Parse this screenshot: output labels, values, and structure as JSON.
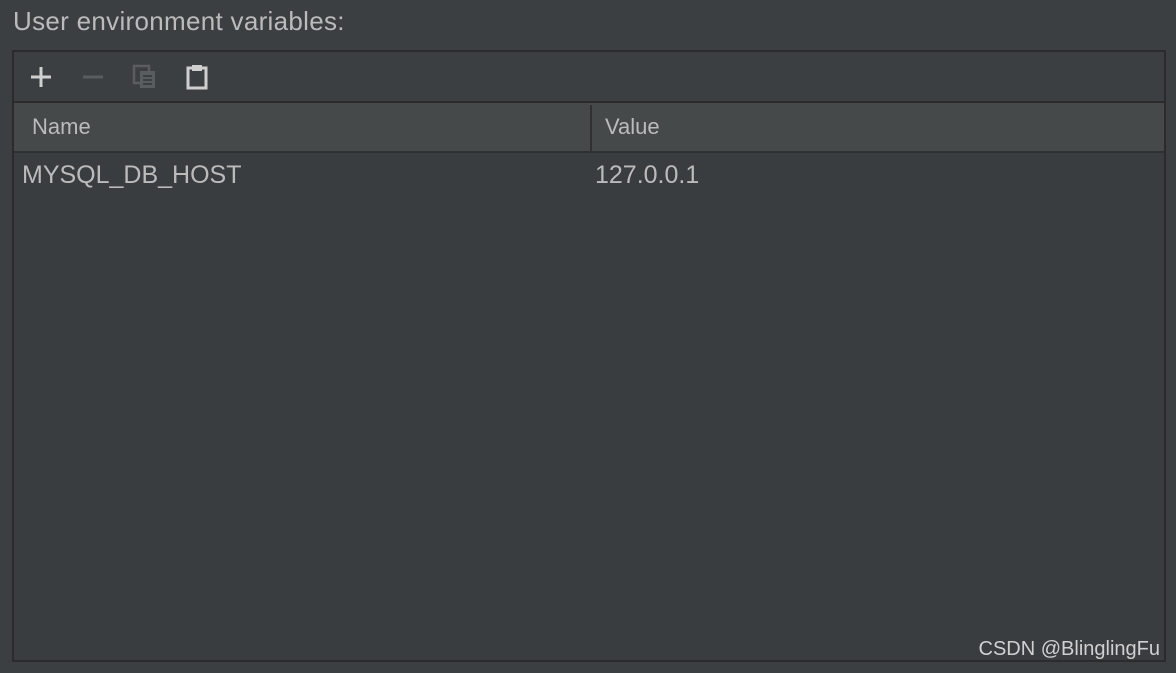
{
  "section": {
    "title": "User environment variables:"
  },
  "toolbar": {
    "add": {
      "icon": "plus-icon",
      "enabled": true
    },
    "remove": {
      "icon": "minus-icon",
      "enabled": false
    },
    "copy": {
      "icon": "copy-icon",
      "enabled": false
    },
    "paste": {
      "icon": "paste-icon",
      "enabled": true
    }
  },
  "table": {
    "columns": [
      "Name",
      "Value"
    ],
    "rows": [
      {
        "name": "MYSQL_DB_HOST",
        "value": "127.0.0.1"
      }
    ]
  },
  "watermark": "CSDN @BlinglingFu",
  "colors": {
    "background": "#3c3f41",
    "header": "#45494a",
    "text": "#bbbbbb",
    "border": "#2b2b2b",
    "icon_enabled": "#cfcfcf",
    "icon_disabled": "#5a5d60"
  }
}
